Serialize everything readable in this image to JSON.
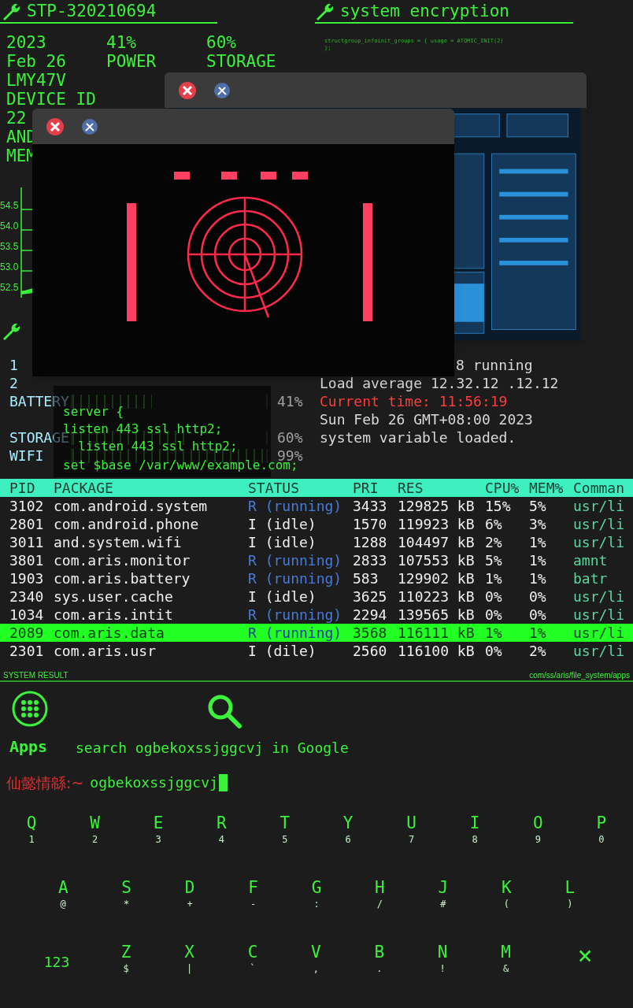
{
  "status_panel": {
    "title": "STP-320210694",
    "columns": [
      [
        "2023",
        "Feb 26",
        "LMY47V",
        "DEVICE ID",
        "22",
        "AND",
        "MEM"
      ],
      [
        "41%",
        "POWER"
      ],
      [
        "60%",
        "STORAGE"
      ]
    ]
  },
  "memory_axis": [
    "54.5",
    "54.0",
    "53.5",
    "53.0",
    "52.5"
  ],
  "encryption_panel": {
    "title": "system encryption",
    "code": [
      "structgroup_infoinit_groups = { usage = ATOMIC_INIT(2)",
      "};"
    ]
  },
  "windows": [
    {
      "kind": "screenshot"
    },
    {
      "kind": "video"
    }
  ],
  "meters": [
    {
      "label": "1"
    },
    {
      "label": "2"
    },
    {
      "label": "BATTERY",
      "level": 0.41,
      "reading": "41%"
    },
    {
      "label": "STORAGE",
      "level": 0.6,
      "reading": "60%"
    },
    {
      "label": "WIFI",
      "level": 0.99,
      "reading": "99%"
    }
  ],
  "system_info": [
    {
      "text": "8 running",
      "kind": "plain"
    },
    {
      "text": "Load average 12.32.12 .12.12",
      "kind": "plain"
    },
    {
      "text": "Current time: 11:56:19",
      "kind": "alert"
    },
    {
      "text": "Sun Feb 26 GMT+08:00 2023",
      "kind": "plain"
    },
    {
      "text": "system variable loaded.",
      "kind": "plain"
    }
  ],
  "code_overlay": {
    "lines": [
      "server {",
      "listen 443 ssl http2;",
      "  listen 443 ssl http2;"
    ],
    "last_line": "set $base /var/www/example.com;"
  },
  "process_table": {
    "columns": [
      "PID",
      "PACKAGE",
      "STATUS",
      "PRI",
      "RES",
      "CPU%",
      "MEM%",
      "Comman"
    ],
    "rows": [
      {
        "pid": "3102",
        "package": "com.android.system",
        "status": "R (running)",
        "running": true,
        "pri": "3433",
        "res": "129825 kB",
        "cpu": "15%",
        "mem": "5%",
        "command": "usr/li",
        "selected": false
      },
      {
        "pid": "2801",
        "package": "com.android.phone",
        "status": "I (idle)",
        "running": false,
        "pri": "1570",
        "res": "119923 kB",
        "cpu": "6%",
        "mem": "3%",
        "command": "usr/li",
        "selected": false
      },
      {
        "pid": "3011",
        "package": "and.system.wifi",
        "status": "I (idle)",
        "running": false,
        "pri": "1288",
        "res": "104497 kB",
        "cpu": "2%",
        "mem": "1%",
        "command": "usr/li",
        "selected": false
      },
      {
        "pid": "3801",
        "package": "com.aris.monitor",
        "status": "R (running)",
        "running": true,
        "pri": "2833",
        "res": "107553 kB",
        "cpu": "5%",
        "mem": "1%",
        "command": "amnt",
        "selected": false
      },
      {
        "pid": "1903",
        "package": "com.aris.battery",
        "status": "R (running)",
        "running": true,
        "pri": "583",
        "res": "129902 kB",
        "cpu": "1%",
        "mem": "1%",
        "command": "batr",
        "selected": false
      },
      {
        "pid": "2340",
        "package": "sys.user.cache",
        "status": "I (idle)",
        "running": false,
        "pri": "3625",
        "res": "110223 kB",
        "cpu": "0%",
        "mem": "0%",
        "command": "usr/li",
        "selected": false
      },
      {
        "pid": "1034",
        "package": "com.aris.intit",
        "status": "R (running)",
        "running": true,
        "pri": "2294",
        "res": "139565 kB",
        "cpu": "0%",
        "mem": "0%",
        "command": "usr/li",
        "selected": false
      },
      {
        "pid": "2089",
        "package": "com.aris.data",
        "status": "R (running)",
        "running": true,
        "pri": "3568",
        "res": "116111 kB",
        "cpu": "1%",
        "mem": "1%",
        "command": "usr/li",
        "selected": true
      },
      {
        "pid": "2301",
        "package": "com.aris.usr",
        "status": "I (dile)",
        "running": false,
        "pri": "2560",
        "res": "116100 kB",
        "cpu": "0%",
        "mem": "2%",
        "command": "usr/li",
        "selected": false
      }
    ]
  },
  "footer": {
    "left": "SYSTEM RESULT",
    "right": "com/ss/aris/file_system/apps"
  },
  "launcher": {
    "apps_label": "Apps",
    "search_text": "search ogbekoxssjggcvj in Google"
  },
  "prompt": {
    "host": "仙懿情緜:~",
    "input": "ogbekoxssjggcvj"
  },
  "keyboard": {
    "rows": [
      [
        {
          "kind": "char",
          "key": "Q",
          "sub": "1"
        },
        {
          "kind": "char",
          "key": "W",
          "sub": "2"
        },
        {
          "kind": "char",
          "key": "E",
          "sub": "3"
        },
        {
          "kind": "char",
          "key": "R",
          "sub": "4"
        },
        {
          "kind": "char",
          "key": "T",
          "sub": "5"
        },
        {
          "kind": "char",
          "key": "Y",
          "sub": "6"
        },
        {
          "kind": "char",
          "key": "U",
          "sub": "7"
        },
        {
          "kind": "char",
          "key": "I",
          "sub": "8"
        },
        {
          "kind": "char",
          "key": "O",
          "sub": "9"
        },
        {
          "kind": "char",
          "key": "P",
          "sub": "0"
        }
      ],
      [
        {
          "kind": "char",
          "key": "A",
          "sub": "@"
        },
        {
          "kind": "char",
          "key": "S",
          "sub": "*"
        },
        {
          "kind": "char",
          "key": "D",
          "sub": "+"
        },
        {
          "kind": "char",
          "key": "F",
          "sub": "-"
        },
        {
          "kind": "char",
          "key": "G",
          "sub": ":"
        },
        {
          "kind": "char",
          "key": "H",
          "sub": "/"
        },
        {
          "kind": "char",
          "key": "J",
          "sub": "#"
        },
        {
          "kind": "char",
          "key": "K",
          "sub": "("
        },
        {
          "kind": "char",
          "key": "L",
          "sub": ")"
        }
      ],
      [
        {
          "kind": "mode",
          "key": "123"
        },
        {
          "kind": "char",
          "key": "Z",
          "sub": "$"
        },
        {
          "kind": "char",
          "key": "X",
          "sub": "|"
        },
        {
          "kind": "char",
          "key": "C",
          "sub": "`"
        },
        {
          "kind": "char",
          "key": "V",
          "sub": ","
        },
        {
          "kind": "char",
          "key": "B",
          "sub": "."
        },
        {
          "kind": "char",
          "key": "N",
          "sub": "!"
        },
        {
          "kind": "char",
          "key": "M",
          "sub": "&"
        },
        {
          "kind": "delete",
          "key": "×"
        }
      ]
    ]
  }
}
